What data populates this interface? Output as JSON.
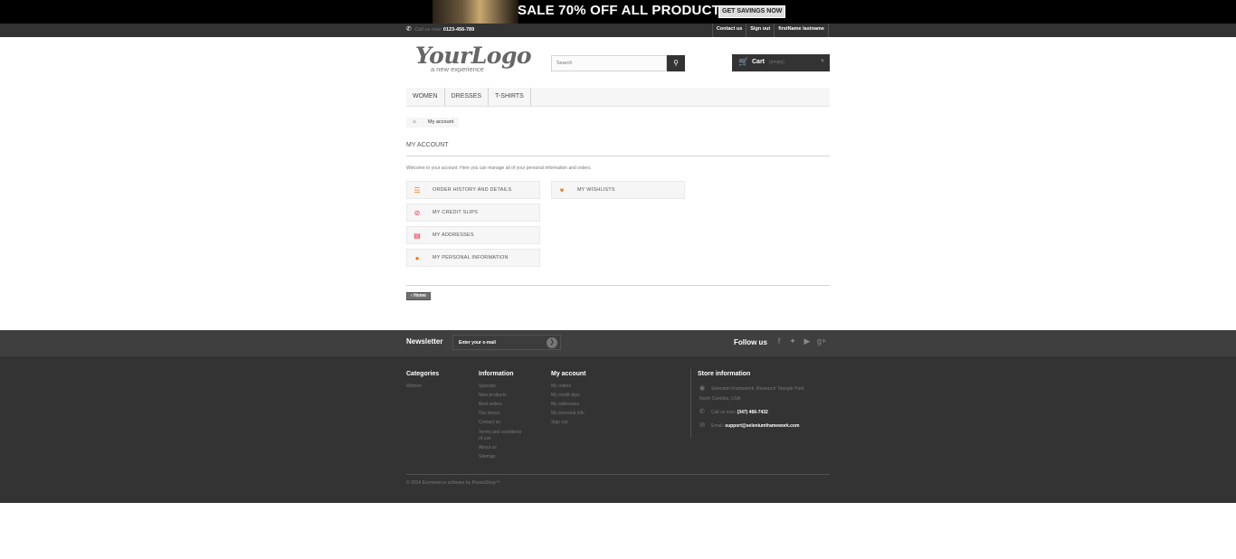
{
  "banner": {
    "text": "SALE 70% OFF ALL PRODUCTS",
    "button": "GET SAVINGS NOW"
  },
  "nav": {
    "phone_label": "Call us now:",
    "phone_number": "0123-456-789",
    "links": [
      "Contact us",
      "Sign out",
      "firstName lastname"
    ]
  },
  "header": {
    "logo_main": "YourLogo",
    "logo_sub": "a new experience",
    "search_placeholder": "Search",
    "cart_label": "Cart",
    "cart_status": "(empty)"
  },
  "menu": [
    "WOMEN",
    "DRESSES",
    "T-SHIRTS"
  ],
  "breadcrumb": {
    "current": "My account"
  },
  "page": {
    "heading": "MY ACCOUNT",
    "welcome": "Welcome to your account. Here you can manage all of your personal information and orders.",
    "buttons": {
      "order_history": "ORDER HISTORY AND DETAILS",
      "credit_slips": "MY CREDIT SLIPS",
      "addresses": "MY ADDRESSES",
      "personal_info": "MY PERSONAL INFORMATION",
      "wishlists": "MY WISHLISTS"
    },
    "home_button": "Home"
  },
  "newsletter": {
    "label": "Newsletter",
    "placeholder": "Enter your e-mail"
  },
  "follow_label": "Follow us",
  "footer": {
    "categories": {
      "title": "Categories",
      "items": [
        "Women"
      ]
    },
    "information": {
      "title": "Information",
      "items": [
        "Specials",
        "New products",
        "Best sellers",
        "Our stores",
        "Contact us",
        "Terms and conditions",
        "of use",
        "About us",
        "Sitemap"
      ]
    },
    "my_account": {
      "title": "My account",
      "items": [
        "My orders",
        "My credit slips",
        "My addresses",
        "My personal info",
        "Sign out"
      ]
    },
    "store": {
      "title": "Store information",
      "address_1": "Selenium Framework, Research Triangle Park,",
      "address_2": "North Carolina, USA",
      "call_label": "Call us now:",
      "phone": "(347) 466-7432",
      "email_label": "Email:",
      "email": "support@seleniumframework.com"
    },
    "copyright": "© 2014 Ecommerce software by PrestaShop™"
  }
}
